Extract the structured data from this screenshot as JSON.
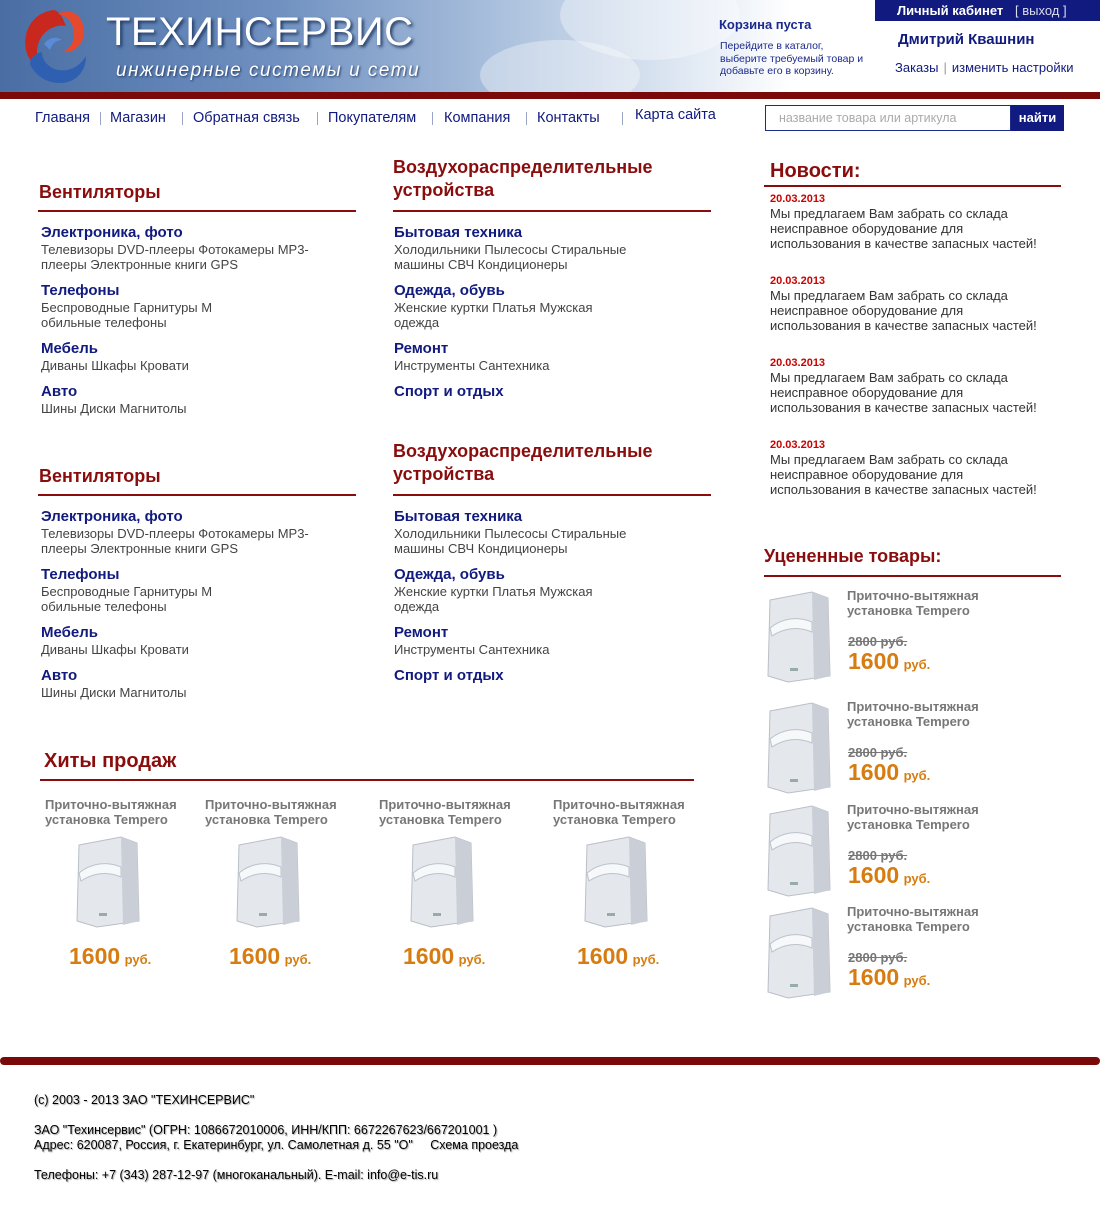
{
  "header": {
    "logo_title": "ТЕХИНСЕРВИС",
    "logo_subtitle": "инжинерные системы и сети",
    "cart_title": "Корзина пуста",
    "cart_text": "Перейдите в каталог, выберите требуемый товар и добавьте его в корзину.",
    "cabinet_label": "Личный кабинет",
    "exit_label": "[ выход ]",
    "user_name": "Дмитрий Квашнин",
    "orders_link": "Заказы",
    "settings_link": "изменить настройки"
  },
  "nav": {
    "items": [
      "Главаня",
      "Магазин",
      "Обратная связь",
      "Покупателям",
      "Компания",
      "Контакты",
      "Карта сайта"
    ]
  },
  "search": {
    "placeholder": "название товара или артикула",
    "button": "найти"
  },
  "categories": {
    "left_title": "Вентиляторы",
    "right_title": "Воздухораспределительные устройства",
    "left_items": [
      {
        "title": "Электроника, фото",
        "desc": "Телевизоры DVD-плееры Фотокамеры MP3-плееры Электронные книги GPS"
      },
      {
        "title": "Телефоны",
        "desc": "Беспроводные Гарнитуры М обильные телефоны"
      },
      {
        "title": "Мебель",
        "desc": "Диваны Шкафы Кровати"
      },
      {
        "title": "Авто",
        "desc": "Шины Диски Магнитолы"
      }
    ],
    "right_items": [
      {
        "title": "Бытовая техника",
        "desc": "Холодильники Пылесосы Стиральные машины СВЧ Кондиционеры"
      },
      {
        "title": "Одежда, обувь",
        "desc": "Женские куртки Платья Мужская одежда"
      },
      {
        "title": "Ремонт",
        "desc": "Инструменты Сантехника"
      },
      {
        "title": "Спорт и отдых",
        "desc": ""
      }
    ]
  },
  "news": {
    "title": "Новости:",
    "items": [
      {
        "date": "20.03.2013",
        "text": "Мы предлагаем Вам забрать со склада неисправное оборудование для использования в качестве запасных частей!"
      },
      {
        "date": "20.03.2013",
        "text": "Мы предлагаем Вам забрать со склада неисправное оборудование для использования в качестве запасных частей!"
      },
      {
        "date": "20.03.2013",
        "text": "Мы предлагаем Вам забрать со склада неисправное оборудование для использования в качестве запасных частей!"
      },
      {
        "date": "20.03.2013",
        "text": "Мы предлагаем Вам забрать со склада неисправное оборудование для использования в качестве запасных частей!"
      }
    ]
  },
  "discounted": {
    "title": "Уцененные товары:",
    "items": [
      {
        "name": "Приточно-вытяжная установка Tempero",
        "old_price": "2800 руб.",
        "price": "1600",
        "unit": "руб."
      },
      {
        "name": "Приточно-вытяжная установка Tempero",
        "old_price": "2800 руб.",
        "price": "1600",
        "unit": "руб."
      },
      {
        "name": "Приточно-вытяжная установка Tempero",
        "old_price": "2800 руб.",
        "price": "1600",
        "unit": "руб."
      },
      {
        "name": "Приточно-вытяжная установка Tempero",
        "old_price": "2800 руб.",
        "price": "1600",
        "unit": "руб."
      }
    ]
  },
  "hits": {
    "title": "Хиты продаж",
    "items": [
      {
        "name": "Приточно-вытяжная установка Tempero",
        "price": "1600",
        "unit": "руб."
      },
      {
        "name": "Приточно-вытяжная установка Tempero",
        "price": "1600",
        "unit": "руб."
      },
      {
        "name": "Приточно-вытяжная установка Tempero",
        "price": "1600",
        "unit": "руб."
      },
      {
        "name": "Приточно-вытяжная установка Tempero",
        "price": "1600",
        "unit": "руб."
      }
    ]
  },
  "footer": {
    "copyright": "(с) 2003 - 2013  ЗАО \"ТЕХИНСЕРВИС\"",
    "company": "ЗАО \"Техинсервис\" (ОГРН: 1086672010006, ИНН/КПП: 6672267623/667201001 )",
    "address": "Адрес: 620087, Россия, г. Екатеринбург, ул. Самолетная д. 55 \"О\"",
    "map_link": "Схема проезда",
    "phones": "Телефоны: +7 (343) 287-12-97 (многоканальный). E-mail: info@e-tis.ru"
  },
  "colors": {
    "brand_red": "#8a0d0d",
    "nav_blue": "#111a7e",
    "price_orange": "#d67c10"
  }
}
